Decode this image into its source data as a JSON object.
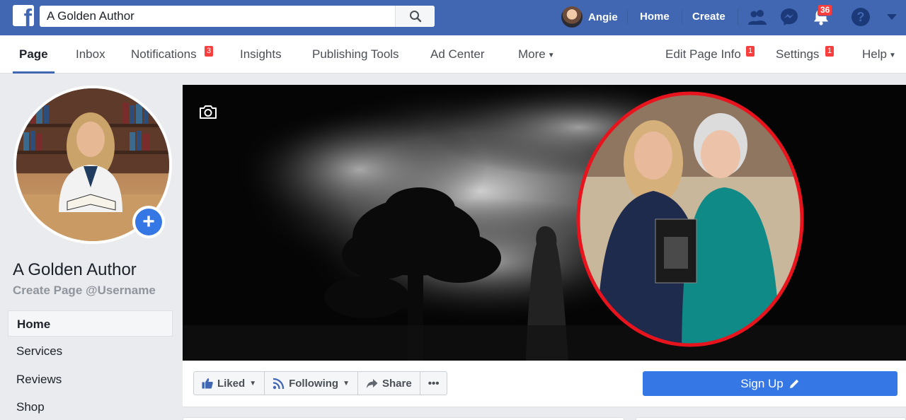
{
  "topbar": {
    "search_value": "A Golden Author",
    "user_name": "Angie",
    "home": "Home",
    "create": "Create",
    "notification_count": "36"
  },
  "pagetabs": {
    "page": "Page",
    "inbox": "Inbox",
    "notifications": "Notifications",
    "notifications_badge": "3",
    "insights": "Insights",
    "publishing_tools": "Publishing Tools",
    "ad_center": "Ad Center",
    "more": "More",
    "edit_page_info": "Edit Page Info",
    "edit_page_info_badge": "1",
    "settings": "Settings",
    "settings_badge": "1",
    "help": "Help"
  },
  "sidebar": {
    "page_name": "A Golden Author",
    "create_username": "Create Page @Username",
    "items": [
      "Home",
      "Services",
      "Reviews",
      "Shop"
    ]
  },
  "actions": {
    "liked": "Liked",
    "following": "Following",
    "share": "Share",
    "more": "•••",
    "signup": "Sign Up"
  },
  "colors": {
    "brand_blue": "#4267b2",
    "button_blue": "#3578e5",
    "badge_red": "#fa3e3e",
    "cover_ring": "#e8141d"
  },
  "icons": [
    "facebook-logo-icon",
    "search-icon",
    "friends-icon",
    "messenger-icon",
    "bell-icon",
    "help-icon",
    "caret-down-icon",
    "camera-icon",
    "plus-icon",
    "thumbs-up-icon",
    "rss-icon",
    "share-arrow-icon",
    "pencil-icon"
  ]
}
